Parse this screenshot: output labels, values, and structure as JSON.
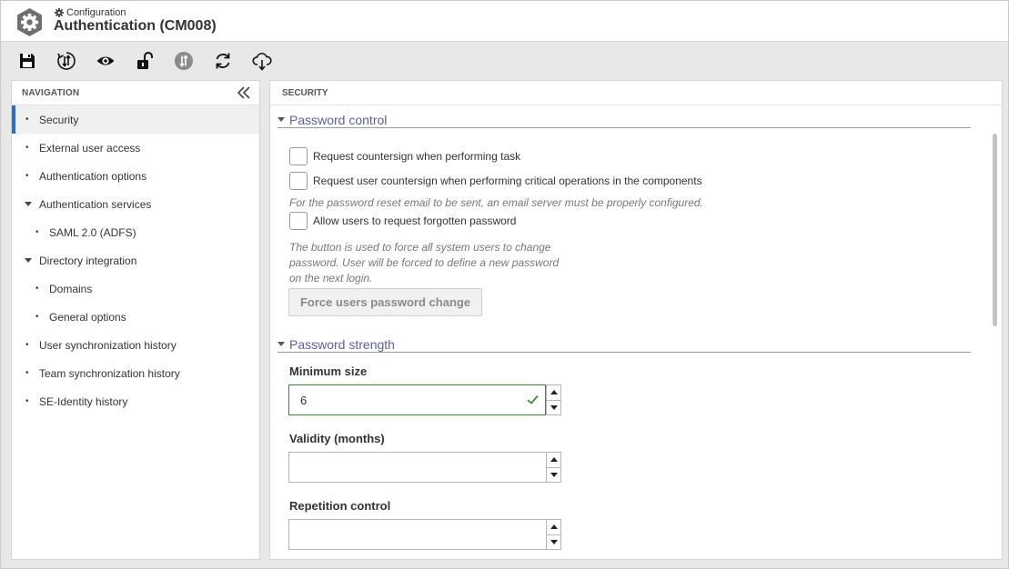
{
  "header": {
    "breadcrumb": "Configuration",
    "title": "Authentication (CM008)"
  },
  "toolbar": {
    "buttons": [
      "save-icon",
      "sync-circle-icon",
      "eye-icon",
      "unlock-icon",
      "transfer-icon",
      "refresh-icon",
      "cloud-download-icon"
    ]
  },
  "nav": {
    "heading": "NAVIGATION",
    "items": [
      {
        "label": "Security",
        "level": 0,
        "marker": "•"
      },
      {
        "label": "External user access",
        "level": 0,
        "marker": "•"
      },
      {
        "label": "Authentication options",
        "level": 0,
        "marker": "•"
      },
      {
        "label": "Authentication services",
        "level": 0,
        "marker": "caret"
      },
      {
        "label": "SAML 2.0 (ADFS)",
        "level": 1,
        "marker": "•"
      },
      {
        "label": "Directory integration",
        "level": 0,
        "marker": "caret"
      },
      {
        "label": "Domains",
        "level": 1,
        "marker": "•"
      },
      {
        "label": "General options",
        "level": 1,
        "marker": "•"
      },
      {
        "label": "User synchronization history",
        "level": 0,
        "marker": "•"
      },
      {
        "label": "Team synchronization history",
        "level": 0,
        "marker": "•"
      },
      {
        "label": "SE-Identity history",
        "level": 0,
        "marker": "•"
      }
    ]
  },
  "main": {
    "heading": "SECURITY",
    "password_control": {
      "title": "Password control",
      "checkbox_countersign_task": "Request countersign when performing task",
      "checkbox_countersign_critical": "Request user countersign when performing critical operations in the components",
      "hint_email": "For the password reset email to be sent, an email server must be properly configured.",
      "checkbox_forgotten": "Allow users to request forgotten password",
      "hint_force_line1": "The button is used to force all system users to change",
      "hint_force_line2": "password. User will be forced to define a new password",
      "hint_force_line3": "on the next login.",
      "force_button": "Force users password change"
    },
    "password_strength": {
      "title": "Password strength",
      "min_size_label": "Minimum size",
      "min_size_value": "6",
      "validity_label": "Validity (months)",
      "validity_value": "",
      "repetition_label": "Repetition control",
      "repetition_value": ""
    }
  },
  "colors": {
    "accent": "#2b6cc4",
    "section_title": "#5a5fa8",
    "valid": "#3a8a3a"
  }
}
